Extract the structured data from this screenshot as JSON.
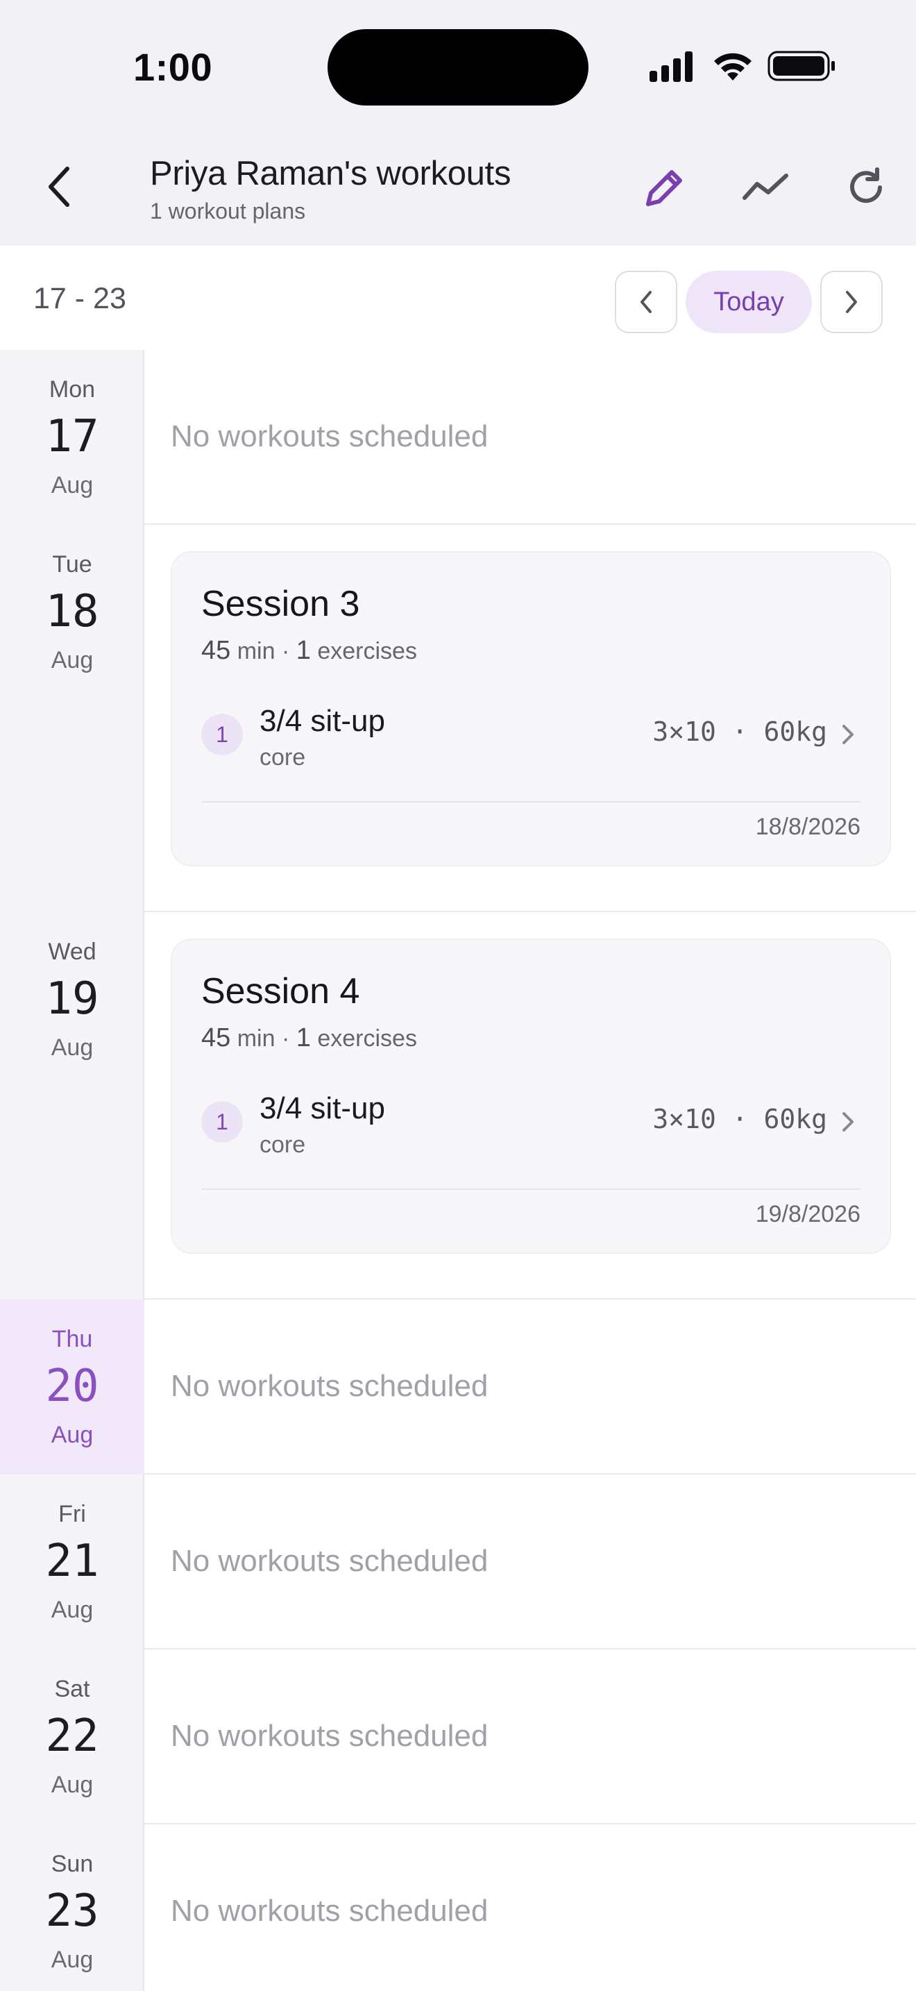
{
  "status_bar": {
    "time": "1:00"
  },
  "header": {
    "title": "Priya Raman's workouts",
    "subtitle": "1 workout plans",
    "accent_color": "#7a3fae",
    "icons": [
      "back-chevron-icon",
      "pencil-icon",
      "trend-line-icon",
      "refresh-icon"
    ]
  },
  "week_nav": {
    "range": "17 - 23",
    "today_label": "Today"
  },
  "days": [
    {
      "weekday": "Mon",
      "day": "17",
      "month": "Aug",
      "empty_text": "No workouts scheduled"
    },
    {
      "weekday": "Tue",
      "day": "18",
      "month": "Aug",
      "session": {
        "title": "Session 3",
        "minutes": "45",
        "minutes_unit": "min",
        "exercise_count": "1",
        "exercise_unit": "exercises",
        "exercise": {
          "index": "1",
          "name": "3/4 sit-up",
          "category": "core",
          "sets": "3×10 · 60kg"
        },
        "date": "18/8/2026"
      }
    },
    {
      "weekday": "Wed",
      "day": "19",
      "month": "Aug",
      "session": {
        "title": "Session 4",
        "minutes": "45",
        "minutes_unit": "min",
        "exercise_count": "1",
        "exercise_unit": "exercises",
        "exercise": {
          "index": "1",
          "name": "3/4 sit-up",
          "category": "core",
          "sets": "3×10 · 60kg"
        },
        "date": "19/8/2026"
      }
    },
    {
      "weekday": "Thu",
      "day": "20",
      "month": "Aug",
      "empty_text": "No workouts scheduled",
      "is_today": true
    },
    {
      "weekday": "Fri",
      "day": "21",
      "month": "Aug",
      "empty_text": "No workouts scheduled"
    },
    {
      "weekday": "Sat",
      "day": "22",
      "month": "Aug",
      "empty_text": "No workouts scheduled"
    },
    {
      "weekday": "Sun",
      "day": "23",
      "month": "Aug",
      "empty_text": "No workouts scheduled"
    }
  ]
}
